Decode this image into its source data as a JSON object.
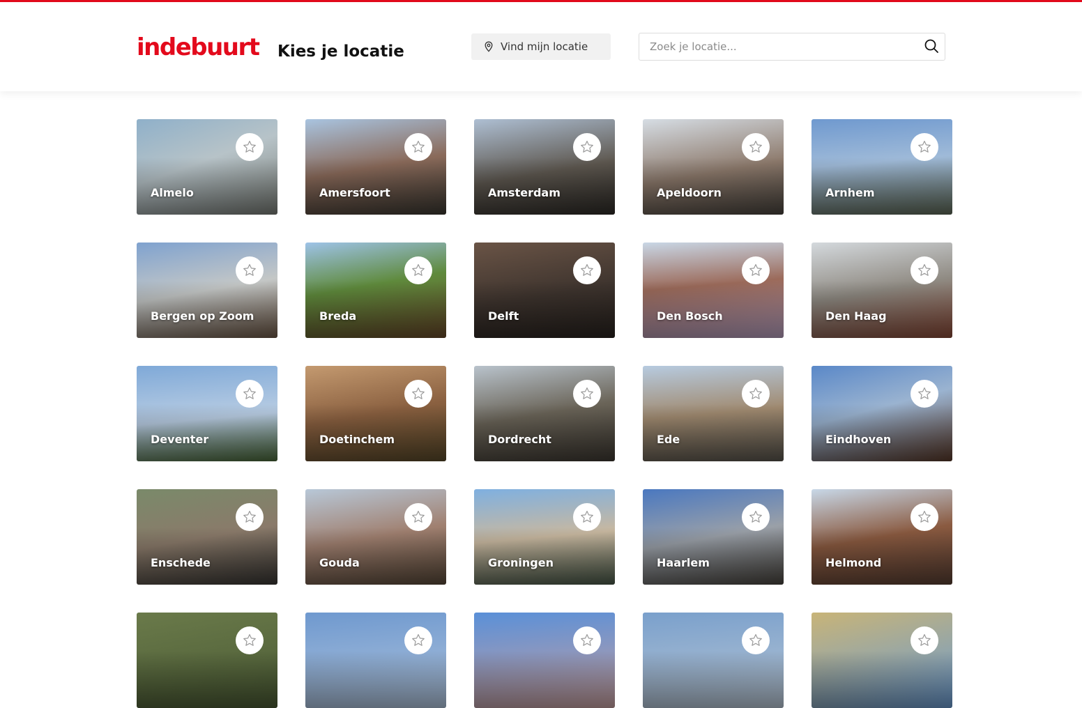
{
  "brand": {
    "logo_text": "indebuurt",
    "accent": "#e30a1c"
  },
  "header": {
    "title": "Kies je locatie",
    "locate_label": "Vind mijn locatie",
    "search_placeholder": "Zoek je locatie..."
  },
  "icons": {
    "pin": "map-pin-icon",
    "search": "search-icon",
    "favorite": "star-outline-icon"
  },
  "cities": [
    {
      "name": "Almelo",
      "bg": "linear-gradient(160deg,#8fb0c9 0%,#b7c3c8 45%,#7a7e78 100%)"
    },
    {
      "name": "Amersfoort",
      "bg": "linear-gradient(170deg,#a9c4e0 0%,#8a6a5a 50%,#3d3a33 100%)"
    },
    {
      "name": "Amsterdam",
      "bg": "linear-gradient(170deg,#aebfd3 0%,#5e5850 55%,#2f2c28 100%)"
    },
    {
      "name": "Apeldoorn",
      "bg": "linear-gradient(170deg,#d6dde4 0%,#8d7a6c 55%,#4a453f 100%)"
    },
    {
      "name": "Arnhem",
      "bg": "linear-gradient(175deg,#6f99cf 0%,#9fbad8 45%,#5f6a58 100%)"
    },
    {
      "name": "Bergen op Zoom",
      "bg": "linear-gradient(170deg,#7fa2cf 0%,#c4c7c6 50%,#6f5a48 100%)"
    },
    {
      "name": "Breda",
      "bg": "linear-gradient(170deg,#9ec3e8 0%,#5f8a3c 45%,#6a4a2a 100%)"
    },
    {
      "name": "Delft",
      "bg": "linear-gradient(170deg,#6a5446 0%,#3e342e 55%,#2a2420 100%)"
    },
    {
      "name": "Den Bosch",
      "bg": "linear-gradient(175deg,#c9d7e6 0%,#9b6a5a 45%,#b8a0c0 100%)"
    },
    {
      "name": "Den Haag",
      "bg": "linear-gradient(170deg,#d4d9dd 0%,#8f8a82 50%,#8a4a38 100%)"
    },
    {
      "name": "Deventer",
      "bg": "linear-gradient(175deg,#7fa9d8 0%,#b9cde3 55%,#4b6a3a 100%)"
    },
    {
      "name": "Doetinchem",
      "bg": "linear-gradient(170deg,#c49a70 0%,#8a6040 50%,#5a4a2a 100%)"
    },
    {
      "name": "Dordrecht",
      "bg": "linear-gradient(170deg,#b9c3cc 0%,#6a6458 50%,#3f3a33 100%)"
    },
    {
      "name": "Ede",
      "bg": "linear-gradient(175deg,#b7cbe0 0%,#a08a70 50%,#5a564e 100%)"
    },
    {
      "name": "Eindhoven",
      "bg": "linear-gradient(165deg,#5a88c8 0%,#9ab3d0 45%,#5a3a2a 100%)"
    },
    {
      "name": "Enschede",
      "bg": "linear-gradient(170deg,#7a8a6a 0%,#8a7a6a 50%,#3a3835 100%)"
    },
    {
      "name": "Gouda",
      "bg": "linear-gradient(170deg,#b8c8d8 0%,#a08070 50%,#5a4a3a 100%)"
    },
    {
      "name": "Groningen",
      "bg": "linear-gradient(175deg,#7fb0e0 0%,#c8b8a0 50%,#4a5a4a 100%)"
    },
    {
      "name": "Haarlem",
      "bg": "linear-gradient(170deg,#4a78c0 0%,#9aa0a8 50%,#4a4640 100%)"
    },
    {
      "name": "Helmond",
      "bg": "linear-gradient(170deg,#c8d8e8 0%,#8a5a40 50%,#5a4034 100%)"
    },
    {
      "name": "",
      "bg": "linear-gradient(170deg,#6a7a4a 0%,#4a5a34 100%)"
    },
    {
      "name": "",
      "bg": "linear-gradient(175deg,#6f99cf 0%,#b0c4dc 100%)"
    },
    {
      "name": "",
      "bg": "linear-gradient(175deg,#5a90d8 0%,#c8a0a0 100%)"
    },
    {
      "name": "",
      "bg": "linear-gradient(175deg,#7aa0cc 0%,#b8c6d4 100%)"
    },
    {
      "name": "",
      "bg": "linear-gradient(165deg,#c8b478 0%,#6a9ad0 100%)"
    }
  ]
}
